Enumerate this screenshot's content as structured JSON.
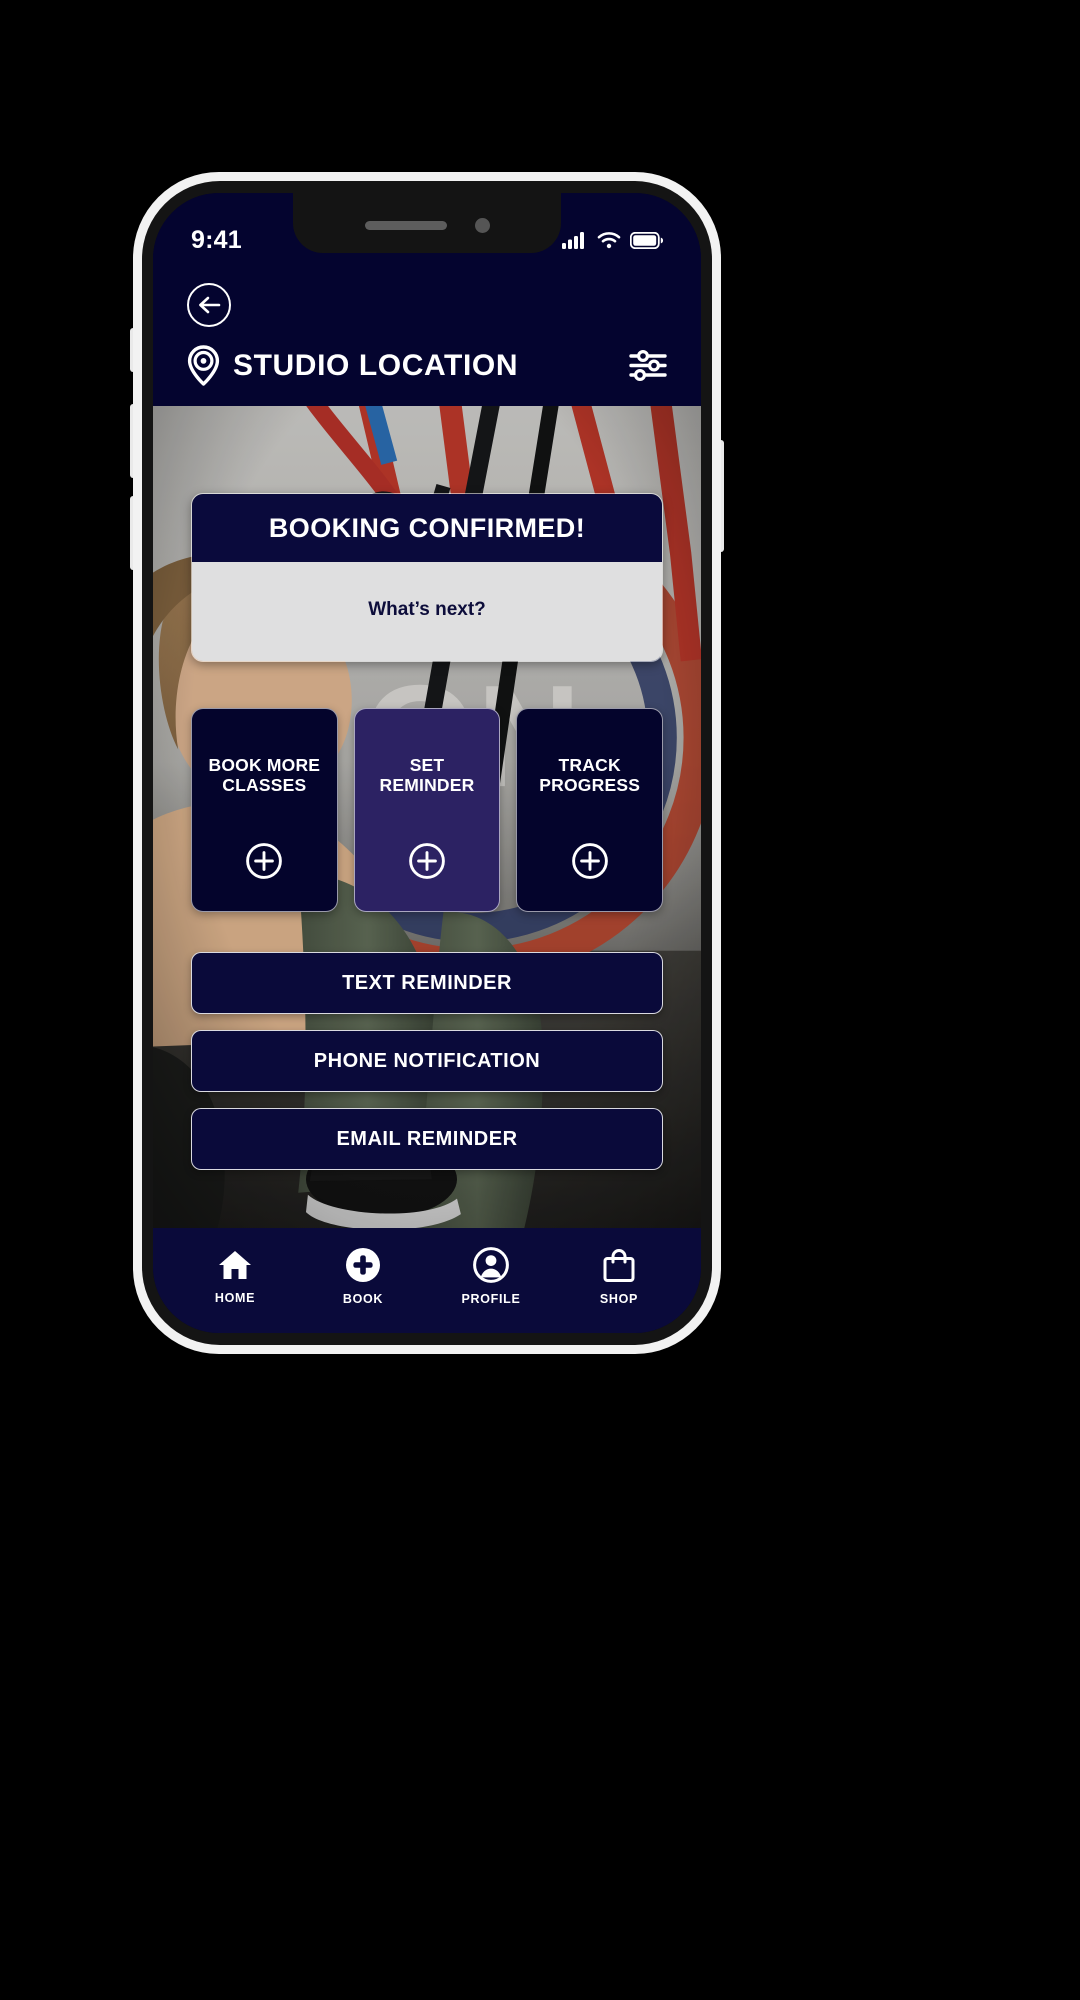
{
  "status_bar": {
    "time": "9:41",
    "signal_icon": "cellular-signal-icon",
    "wifi_icon": "wifi-icon",
    "battery_icon": "battery-icon"
  },
  "header": {
    "back_icon": "back-arrow-icon",
    "pin_icon": "location-pin-icon",
    "title": "STUDIO LOCATION",
    "filter_icon": "filter-sliders-icon"
  },
  "confirm_card": {
    "heading": "BOOKING CONFIRMED!",
    "subheading": "What’s next?"
  },
  "action_cards": [
    {
      "label": "BOOK MORE CLASSES",
      "icon": "plus-circle-icon",
      "selected": false
    },
    {
      "label": "SET REMINDER",
      "icon": "plus-circle-icon",
      "selected": true
    },
    {
      "label": "TRACK PROGRESS",
      "icon": "plus-circle-icon",
      "selected": false
    }
  ],
  "reminder_options": [
    {
      "label": "TEXT REMINDER"
    },
    {
      "label": "PHONE NOTIFICATION"
    },
    {
      "label": "EMAIL REMINDER"
    }
  ],
  "bottom_nav": [
    {
      "label": "HOME",
      "icon": "home-icon"
    },
    {
      "label": "BOOK",
      "icon": "plus-circle-filled-icon"
    },
    {
      "label": "PROFILE",
      "icon": "person-circle-icon"
    },
    {
      "label": "SHOP",
      "icon": "shopping-bag-icon"
    }
  ],
  "colors": {
    "navy": "#04042f",
    "card_navy": "#04042c",
    "selected_purple": "#2c2263",
    "confirm_body": "#dfdfe0",
    "text_white": "#ffffff"
  }
}
